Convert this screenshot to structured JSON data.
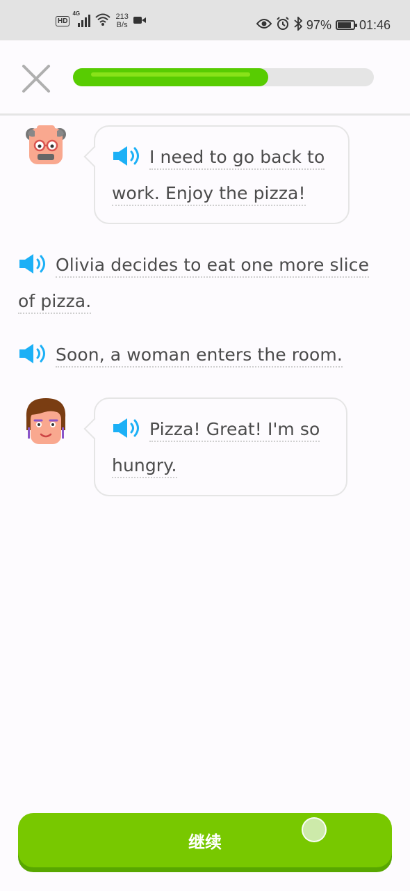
{
  "status_bar": {
    "hd_badge": "HD",
    "network_type": "4G",
    "speed_value": "213",
    "speed_unit": "B/s",
    "battery_percent": "97%",
    "battery_level": 0.97,
    "time": "01:46",
    "icons": [
      "signal-icon",
      "wifi-icon",
      "video-icon",
      "eye-icon",
      "alarm-icon",
      "bluetooth-icon",
      "battery-icon"
    ]
  },
  "lesson": {
    "progress": 0.65,
    "close_icon": "close-icon"
  },
  "story": {
    "lines": [
      {
        "speaker": "old-man",
        "avatar_icon": "old-man-avatar-icon",
        "text_line1": "I need to go back to",
        "text_line2": "work. Enjoy the pizza!"
      },
      {
        "speaker": "narrator",
        "text_line1": "Olivia decides to eat one more slice",
        "text_line2": "of pizza."
      },
      {
        "speaker": "narrator",
        "text_line1": "Soon, a woman enters the room."
      },
      {
        "speaker": "woman",
        "avatar_icon": "woman-avatar-icon",
        "text_line1": "Pizza! Great! I'm so",
        "text_line2": "hungry."
      }
    ]
  },
  "footer": {
    "continue_label": "继续"
  },
  "colors": {
    "accent_green": "#78c800",
    "accent_green_shadow": "#58a700",
    "speaker_blue": "#1cb0f6",
    "text": "#4b4b4b"
  }
}
